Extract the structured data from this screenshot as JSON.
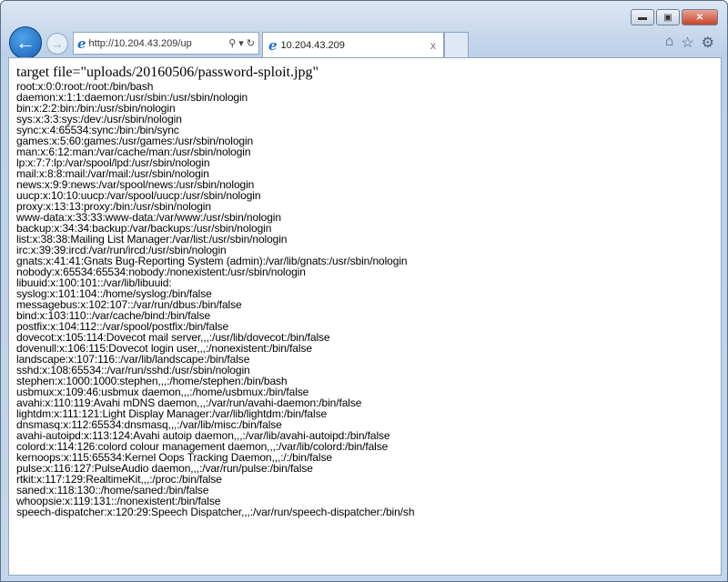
{
  "browser": {
    "address": "http://10.204.43.209/up",
    "tab_title": "10.204.43.209",
    "tab_close": "x"
  },
  "page": {
    "heading": "target file=\"uploads/20160506/password-sploit.jpg\"",
    "lines": [
      "root:x:0:0:root:/root:/bin/bash",
      "daemon:x:1:1:daemon:/usr/sbin:/usr/sbin/nologin",
      "bin:x:2:2:bin:/bin:/usr/sbin/nologin",
      "sys:x:3:3:sys:/dev:/usr/sbin/nologin",
      "sync:x:4:65534:sync:/bin:/bin/sync",
      "games:x:5:60:games:/usr/games:/usr/sbin/nologin",
      "man:x:6:12:man:/var/cache/man:/usr/sbin/nologin",
      "lp:x:7:7:lp:/var/spool/lpd:/usr/sbin/nologin",
      "mail:x:8:8:mail:/var/mail:/usr/sbin/nologin",
      "news:x:9:9:news:/var/spool/news:/usr/sbin/nologin",
      "uucp:x:10:10:uucp:/var/spool/uucp:/usr/sbin/nologin",
      "proxy:x:13:13:proxy:/bin:/usr/sbin/nologin",
      "www-data:x:33:33:www-data:/var/www:/usr/sbin/nologin",
      "backup:x:34:34:backup:/var/backups:/usr/sbin/nologin",
      "list:x:38:38:Mailing List Manager:/var/list:/usr/sbin/nologin",
      "irc:x:39:39:ircd:/var/run/ircd:/usr/sbin/nologin",
      "gnats:x:41:41:Gnats Bug-Reporting System (admin):/var/lib/gnats:/usr/sbin/nologin",
      "nobody:x:65534:65534:nobody:/nonexistent:/usr/sbin/nologin",
      "libuuid:x:100:101::/var/lib/libuuid:",
      "syslog:x:101:104::/home/syslog:/bin/false",
      "messagebus:x:102:107::/var/run/dbus:/bin/false",
      "bind:x:103:110::/var/cache/bind:/bin/false",
      "postfix:x:104:112::/var/spool/postfix:/bin/false",
      "dovecot:x:105:114:Dovecot mail server,,,:/usr/lib/dovecot:/bin/false",
      "dovenull:x:106:115:Dovecot login user,,,:/nonexistent:/bin/false",
      "landscape:x:107:116::/var/lib/landscape:/bin/false",
      "sshd:x:108:65534::/var/run/sshd:/usr/sbin/nologin",
      "stephen:x:1000:1000:stephen,,,:/home/stephen:/bin/bash",
      "usbmux:x:109:46:usbmux daemon,,,:/home/usbmux:/bin/false",
      "avahi:x:110:119:Avahi mDNS daemon,,,:/var/run/avahi-daemon:/bin/false",
      "lightdm:x:111:121:Light Display Manager:/var/lib/lightdm:/bin/false",
      "dnsmasq:x:112:65534:dnsmasq,,,:/var/lib/misc:/bin/false",
      "avahi-autoipd:x:113:124:Avahi autoip daemon,,,:/var/lib/avahi-autoipd:/bin/false",
      "colord:x:114:126:colord colour management daemon,,,:/var/lib/colord:/bin/false",
      "kernoops:x:115:65534:Kernel Oops Tracking Daemon,,,:/:/bin/false",
      "pulse:x:116:127:PulseAudio daemon,,,:/var/run/pulse:/bin/false",
      "rtkit:x:117:129:RealtimeKit,,,:/proc:/bin/false",
      "saned:x:118:130::/home/saned:/bin/false",
      "whoopsie:x:119:131::/nonexistent:/bin/false",
      "speech-dispatcher:x:120:29:Speech Dispatcher,,,:/var/run/speech-dispatcher:/bin/sh"
    ]
  }
}
